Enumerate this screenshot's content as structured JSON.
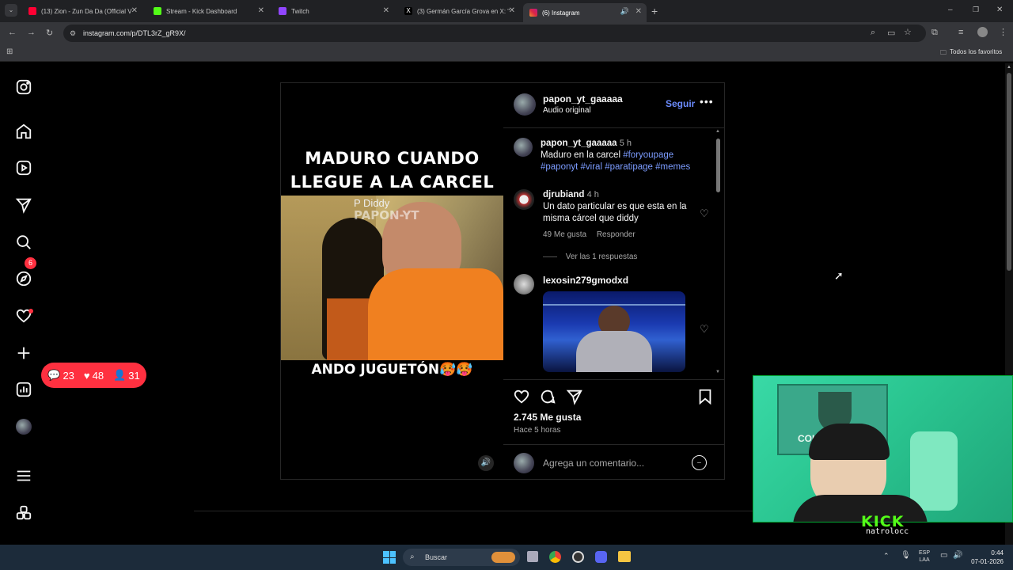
{
  "browser": {
    "tabs": [
      {
        "title": "(13) Zion - Zun Da Da (Official V",
        "color": "#ff0033",
        "active": false
      },
      {
        "title": "Stream - Kick Dashboard",
        "color": "#53fc18",
        "active": false
      },
      {
        "title": "Twitch",
        "color": "#9146ff",
        "active": false
      },
      {
        "title": "(3) Germán García Grova en X: \"",
        "color": "#ffffff",
        "active": false
      },
      {
        "title": "(6) Instagram",
        "color": "#e1306c",
        "active": true
      }
    ],
    "url": "instagram.com/p/DTL3rZ_gR9X/",
    "bookmarks_label": "Todos los favoritos"
  },
  "sidebar": {
    "notification_count": "6",
    "activity": {
      "comments": "23",
      "likes": "48",
      "followers": "31"
    }
  },
  "post": {
    "author": "papon_yt_gaaaaa",
    "audio": "Audio original",
    "follow_label": "Seguir",
    "more_icon": "more-dots-icon",
    "video": {
      "caption_top_line1": "MADURO CUANDO",
      "caption_top_line2": "LLEGUE A LA CARCEL",
      "overlay_label": "P Diddy",
      "watermark": "PAPON-YT",
      "caption_bottom": "ANDO JUGUETÓN🥵🥵"
    },
    "caption": {
      "user": "papon_yt_gaaaaa",
      "time": "5 h",
      "text": "Maduro en la carcel",
      "hashtags_line1": "#foryoupage",
      "hashtags_line2": "#paponyt #viral #paratipage #memes"
    },
    "comments": [
      {
        "user": "djrubiand",
        "time": "4 h",
        "text": "Un dato particular es que esta en la misma cárcel que diddy",
        "likes": "49 Me gusta",
        "reply_label": "Responder",
        "replies_label": "Ver las 1 respuestas"
      },
      {
        "user": "lexosin279gmodxd",
        "type": "image"
      }
    ],
    "likes": "2.745 Me gusta",
    "time_ago": "Hace 5 horas",
    "comment_placeholder": "Agrega un comentario..."
  },
  "stream": {
    "platform": "KICK",
    "username": "natrolocc",
    "jersey_text": "COLO"
  },
  "taskbar": {
    "search_label": "Buscar",
    "lang": "ESP",
    "lang2": "LAA",
    "time": "0:44",
    "date": "07-01-2026"
  }
}
